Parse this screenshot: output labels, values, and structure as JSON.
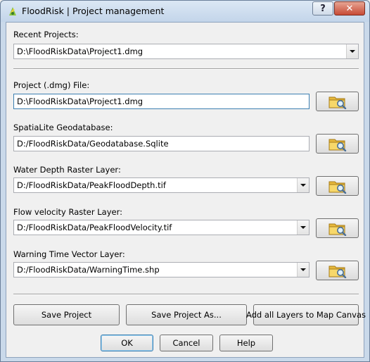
{
  "window": {
    "title": "FloodRisk | Project management",
    "help_label": "?",
    "close_label": "✕"
  },
  "recent": {
    "label": "Recent Projects:",
    "value": "D:\\FloodRiskData\\Project1.dmg"
  },
  "project_file": {
    "label": "Project (.dmg) File:",
    "value": "D:\\FloodRiskData\\Project1.dmg"
  },
  "geodatabase": {
    "label": "SpatiaLite Geodatabase:",
    "value": "D:/FloodRiskData/Geodatabase.Sqlite"
  },
  "water_depth": {
    "label": "Water Depth Raster Layer:",
    "value": "D:/FloodRiskData/PeakFloodDepth.tif"
  },
  "flow_velocity": {
    "label": "Flow velocity Raster Layer:",
    "value": "D:/FloodRiskData/PeakFloodVelocity.tif"
  },
  "warning_time": {
    "label": "Warning Time Vector Layer:",
    "value": "D:/FloodRiskData/WarningTime.shp"
  },
  "actions": {
    "save_project": "Save Project",
    "save_project_as": "Save Project As...",
    "add_layers": "Add all Layers to Map Canvas"
  },
  "footer": {
    "ok": "OK",
    "cancel": "Cancel",
    "help": "Help"
  },
  "icons": {
    "app": "qgis-logo-icon",
    "browse": "folder-search-icon"
  },
  "colors": {
    "titlebar": "#c9d9ea",
    "close": "#c74b36",
    "focus": "#3c7fb1",
    "folder": "#f2cf5b"
  }
}
